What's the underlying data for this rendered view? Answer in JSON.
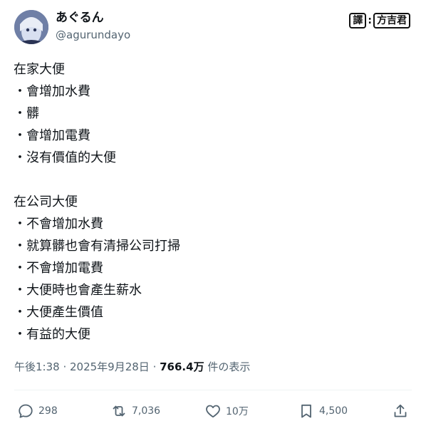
{
  "user": {
    "display_name": "あぐるん",
    "handle": "@agurundayo"
  },
  "watermark": {
    "left": "譯",
    "right": "方吉君"
  },
  "post": {
    "lines": [
      "在家大便",
      "・會增加水費",
      "・髒",
      "・會增加電費",
      "・沒有價值的大便",
      "",
      "在公司大便",
      "・不會增加水費",
      "・就算髒也會有清掃公司打掃",
      "・不會增加電費",
      "・大便時也會產生薪水",
      "・大便產生價值",
      "・有益的大便"
    ]
  },
  "meta": {
    "time": "午後1:38",
    "sep1": " · ",
    "date": "2025年9月28日",
    "sep2": " · ",
    "views_count": "766.4万",
    "views_label": " 件の表示"
  },
  "actions": {
    "reply_count": "298",
    "retweet_count": "7,036",
    "like_count": "10万",
    "bookmark_count": "4,500"
  },
  "icons": {
    "reply": "reply-icon",
    "retweet": "retweet-icon",
    "like": "heart-icon",
    "bookmark": "bookmark-icon",
    "share": "share-icon"
  },
  "colors": {
    "text": "#0f1419",
    "secondary": "#536471",
    "divider": "#eff3f4"
  }
}
